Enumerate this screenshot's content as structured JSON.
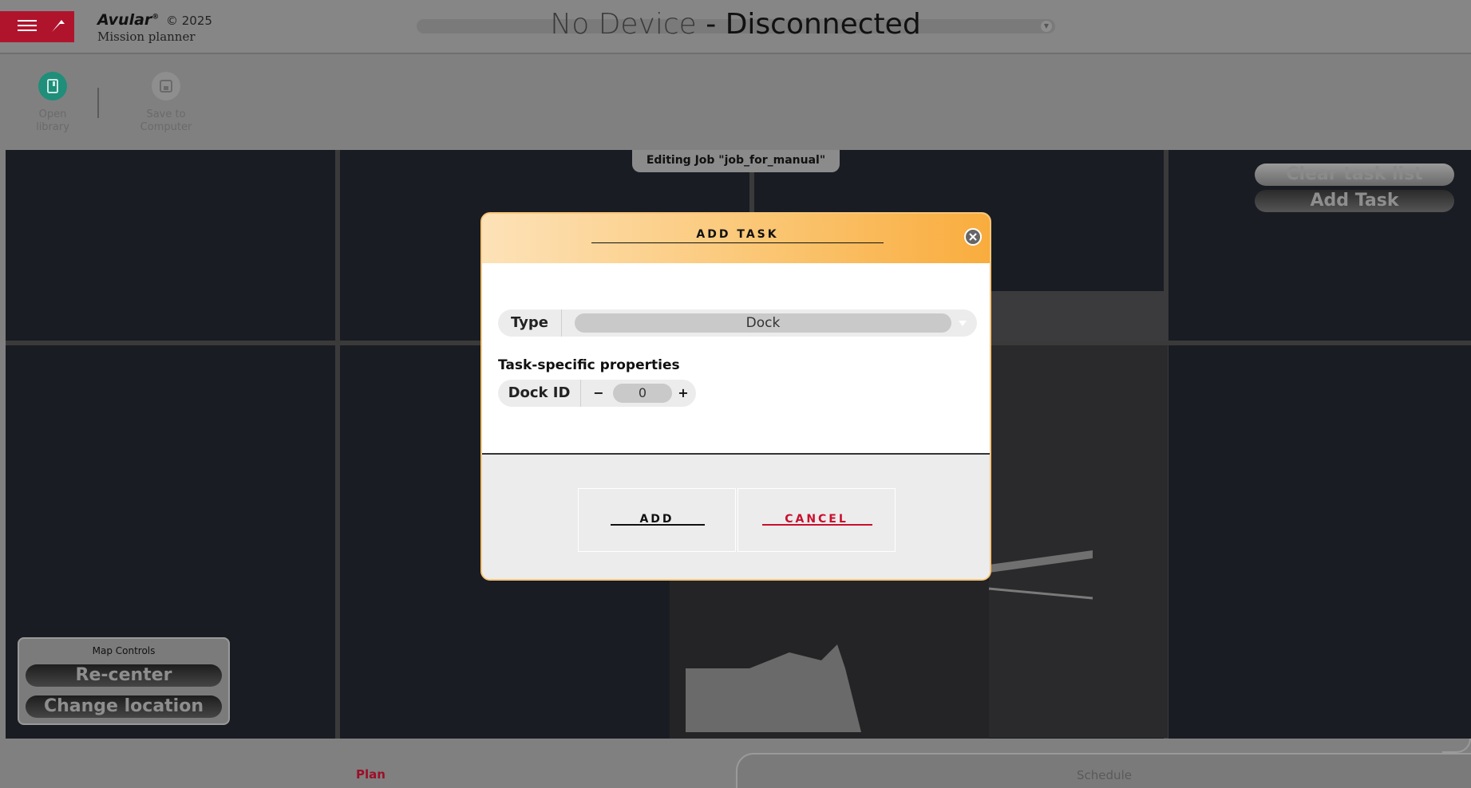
{
  "header": {
    "brand_name": "Avular",
    "brand_reg": "®",
    "copyright": "© 2025",
    "subtitle": "Mission planner",
    "device_name": "No Device",
    "device_status": " - Disconnected"
  },
  "toolbar": {
    "open_library": "Open library",
    "save_to_computer": "Save to Computer"
  },
  "map": {
    "editing_label": "Editing Job \"job_for_manual\"",
    "clear_task_list": "Clear task list",
    "add_task": "Add Task",
    "controls_title": "Map Controls",
    "recenter": "Re-center",
    "change_location": "Change location"
  },
  "modal": {
    "title": "ADD TASK",
    "type_label": "Type",
    "type_value": "Dock",
    "props_title": "Task-specific properties",
    "dock_id_label": "Dock ID",
    "dock_id_value": "0",
    "minus": "−",
    "plus": "+",
    "add_label": "ADD",
    "cancel_label": "CANCEL"
  },
  "tabs": {
    "plan": "Plan",
    "schedule": "Schedule",
    "active": "Plan"
  },
  "colors": {
    "brand_red": "#b0142d",
    "accent_orange": "#f9ac3d",
    "cancel_red": "#c8102e",
    "teal": "#1f8e7a"
  }
}
